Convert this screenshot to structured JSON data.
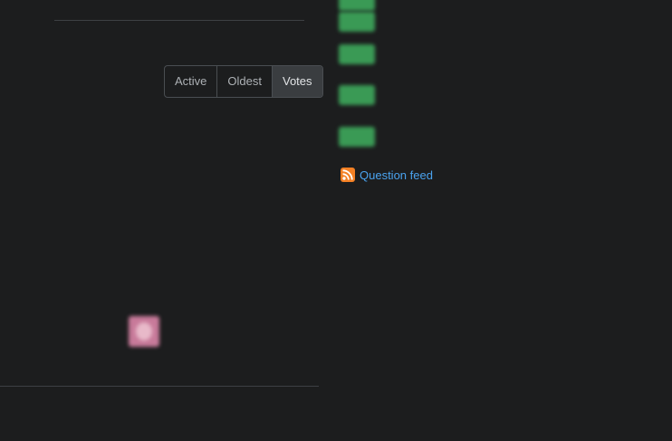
{
  "sort": {
    "options": [
      "Active",
      "Oldest",
      "Votes"
    ],
    "selected": "Votes"
  },
  "answer": {
    "top_fragment": "",
    "para1_line1": "",
    "para1_line2": "",
    "para2_line1": "",
    "para2_line2": "",
    "para2_link": "",
    "para3_link1": "",
    "para3_link2": "",
    "user": {
      "meta": "",
      "name": "",
      "rep": ""
    }
  },
  "related": {
    "items": [
      {
        "score": "",
        "title": ""
      },
      {
        "score": "",
        "title": ""
      },
      {
        "score": "",
        "title": ""
      },
      {
        "score": "",
        "title": ""
      },
      {
        "score": "",
        "title": ""
      }
    ]
  },
  "feed": {
    "label": "Question feed",
    "icon": "rss-icon",
    "icon_color": "#f48024"
  }
}
